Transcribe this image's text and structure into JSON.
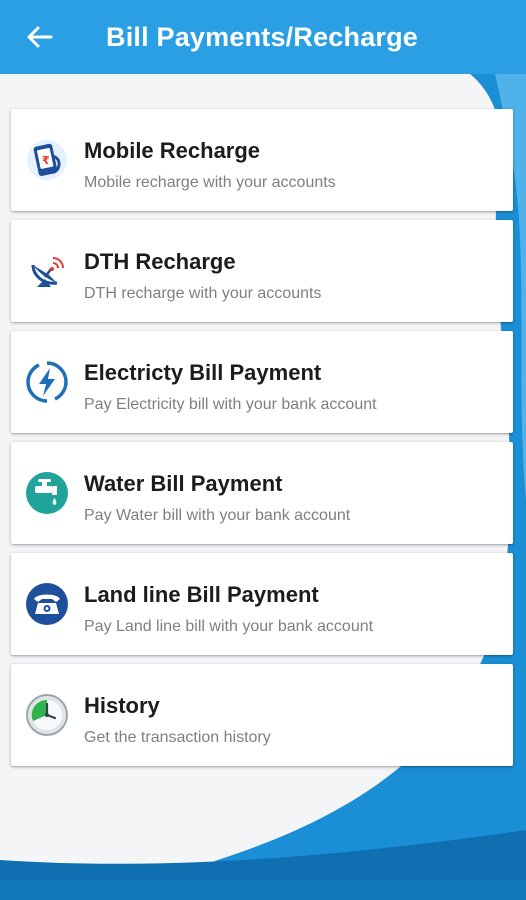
{
  "colors": {
    "app_bar": "#2a9fe3",
    "background_wave": "#1a8fd6",
    "card": "#ffffff",
    "title_text": "#1c1c1c",
    "subtitle_text": "#7f7f7f"
  },
  "appbar": {
    "back_icon": "arrow-back-icon",
    "title": "Bill Payments/Recharge"
  },
  "items": [
    {
      "icon": "mobile-recharge-icon",
      "title": "Mobile Recharge",
      "subtitle": "Mobile recharge with your accounts"
    },
    {
      "icon": "dth-dish-icon",
      "title": "DTH Recharge",
      "subtitle": "DTH recharge with your accounts"
    },
    {
      "icon": "electricity-bolt-icon",
      "title": "Electricty Bill Payment",
      "subtitle": "Pay Electricity bill with your bank account"
    },
    {
      "icon": "water-tap-icon",
      "title": "Water Bill Payment",
      "subtitle": "Pay Water bill with your bank account"
    },
    {
      "icon": "telephone-icon",
      "title": "Land line Bill Payment",
      "subtitle": "Pay Land line bill with your bank account"
    },
    {
      "icon": "history-clock-icon",
      "title": "History",
      "subtitle": "Get the transaction history"
    }
  ]
}
